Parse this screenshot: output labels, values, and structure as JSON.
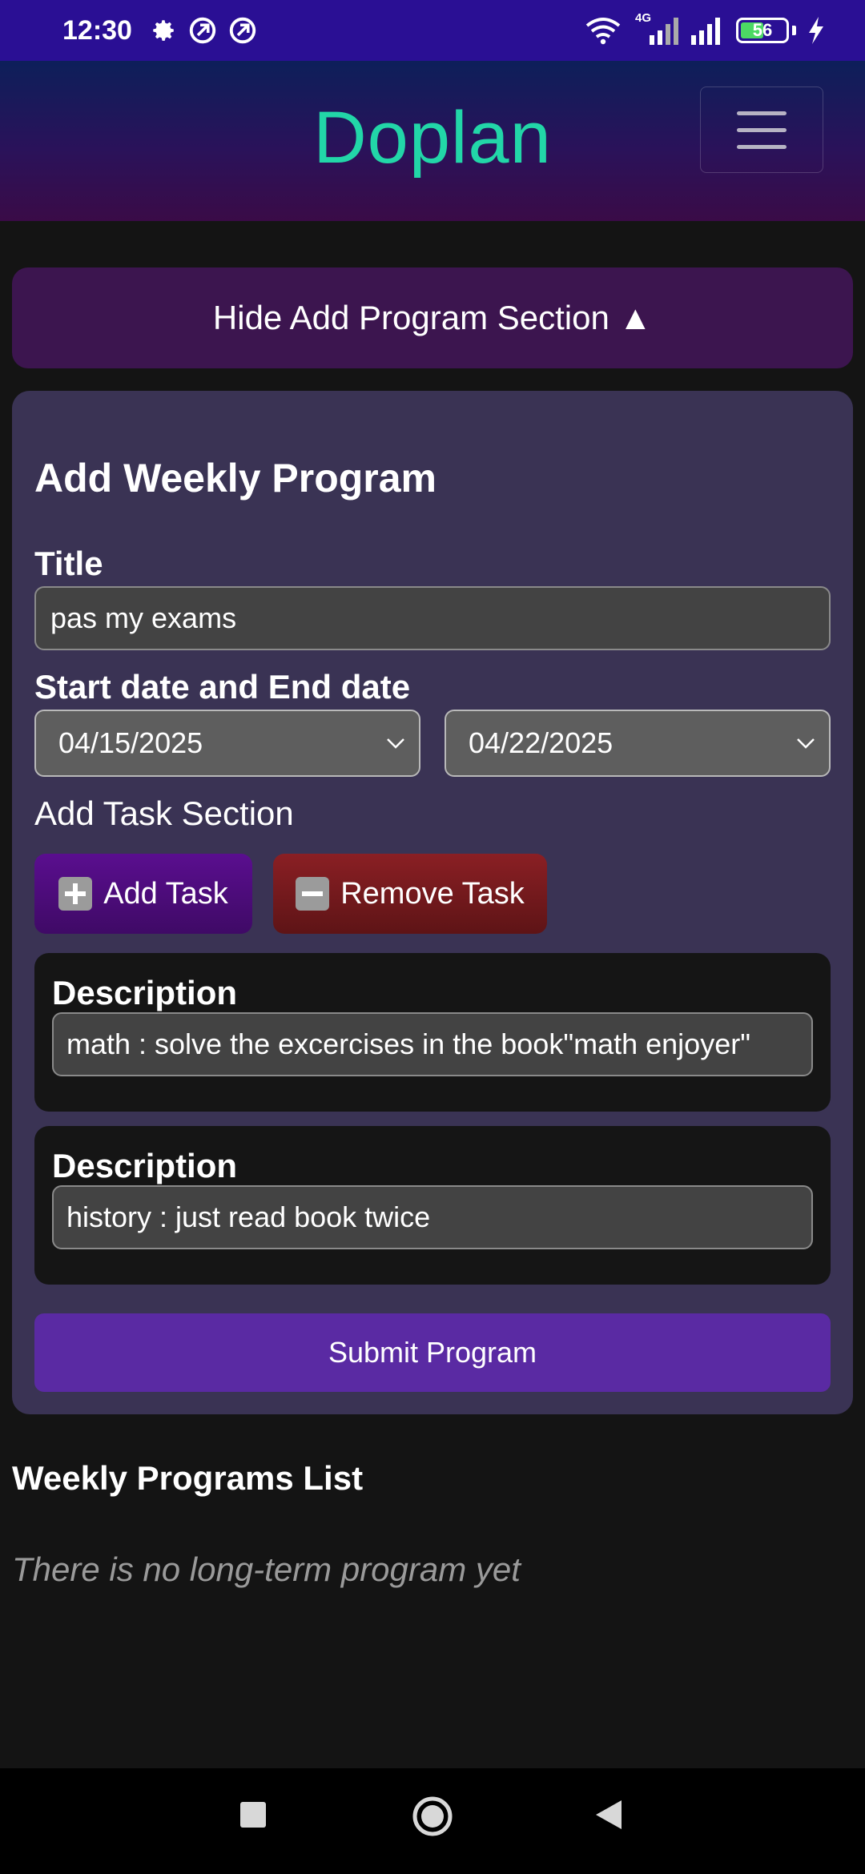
{
  "status_bar": {
    "time": "12:30",
    "network_label": "4G",
    "battery_level": "56",
    "icons": [
      "settings-gear-icon",
      "app-notification-icon",
      "app-notification-icon",
      "wifi-icon",
      "signal-icon",
      "signal-icon",
      "battery-icon",
      "charging-icon"
    ]
  },
  "header": {
    "app_name": "Doplan",
    "menu_icon": "hamburger-menu-icon"
  },
  "toggle": {
    "label": "Hide Add Program Section ▲"
  },
  "form": {
    "heading": "Add Weekly Program",
    "title_label": "Title",
    "title_value": "pas my exams",
    "dates_label": "Start date and End date",
    "start_date": "04/15/2025",
    "end_date": "04/22/2025",
    "task_section_label": "Add Task Section",
    "add_task_label": "Add Task",
    "remove_task_label": "Remove Task",
    "tasks": [
      {
        "label": "Description",
        "value": "math : solve the excercises in the book\"math enjoyer\""
      },
      {
        "label": "Description",
        "value": "history : just read book twice"
      }
    ],
    "submit_label": "Submit Program"
  },
  "list": {
    "title": "Weekly Programs List",
    "empty_message": "There is no long-term program yet"
  },
  "colors": {
    "status_bar": "#2a0f94",
    "brand": "#22d6a8",
    "card": "#3a3354",
    "submit": "#5a2aa3",
    "add_button": "#5a0e8f",
    "remove_button": "#8a1f24"
  }
}
